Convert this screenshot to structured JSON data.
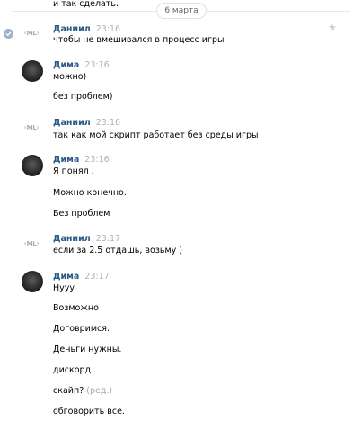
{
  "date_separator": "6 марта",
  "top_cut_text": "и так сделать.",
  "avatar_ml_label": "ML",
  "groups": [
    {
      "author": "Даниил",
      "time": "23:16",
      "lines": [
        "чтобы не вмешивался в процесс игры"
      ]
    },
    {
      "author": "Дима",
      "time": "23:16",
      "lines": [
        "можно)",
        "без проблем)"
      ]
    },
    {
      "author": "Даниил",
      "time": "23:16",
      "lines": [
        "так как мой скрипт работает без среды игры"
      ]
    },
    {
      "author": "Дима",
      "time": "23:16",
      "lines": [
        "Я понял .",
        "Можно конечно.",
        "Без проблем"
      ]
    },
    {
      "author": "Даниил",
      "time": "23:17",
      "lines": [
        "если за 2.5 отдашь, возьму )"
      ]
    },
    {
      "author": "Дима",
      "time": "23:17",
      "lines": [
        "Нууу",
        "Возможно",
        "Договримся.",
        "Деньги нужны.",
        "дискорд",
        "скайп?",
        "обговорить все."
      ]
    }
  ],
  "edited_label": "(ред.)",
  "icons": {
    "check": "check-circle-icon",
    "star": "star-icon"
  },
  "colors": {
    "author": "#2a5885",
    "time": "#a9b2bc",
    "check": "#9fb3c9"
  }
}
